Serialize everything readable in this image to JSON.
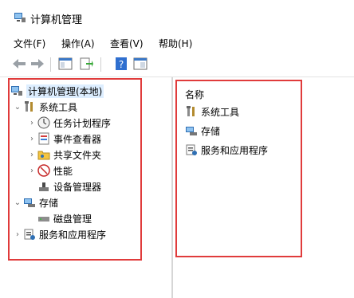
{
  "window": {
    "title": "计算机管理",
    "icon": "computer-management-icon"
  },
  "menu": {
    "file": "文件(F)",
    "action": "操作(A)",
    "view": "查看(V)",
    "help": "帮助(H)"
  },
  "toolbar": {
    "buttons": [
      "back-icon",
      "forward-icon",
      "show-hide-tree-icon",
      "export-list-icon",
      "help-icon",
      "properties-icon"
    ]
  },
  "tree": {
    "root": "计算机管理(本地)",
    "system_tools": "系统工具",
    "task_scheduler": "任务计划程序",
    "event_viewer": "事件查看器",
    "shared_folders": "共享文件夹",
    "performance": "性能",
    "device_manager": "设备管理器",
    "storage": "存储",
    "disk_management": "磁盘管理",
    "services_apps": "服务和应用程序"
  },
  "right_pane": {
    "header": "名称",
    "items": [
      "系统工具",
      "存储",
      "服务和应用程序"
    ]
  },
  "colors": {
    "highlight_border": "#e03b3b",
    "selection_bg": "#ddeeff"
  }
}
